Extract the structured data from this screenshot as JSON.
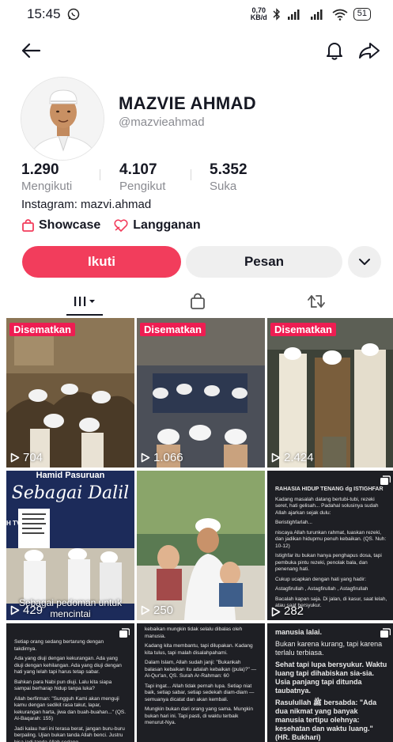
{
  "status_bar": {
    "time": "15:45",
    "speed_value": "0,70",
    "speed_unit": "KB/d",
    "battery": "51"
  },
  "profile": {
    "name": "MAZVIE AHMAD",
    "handle": "@mazvieahmad",
    "stats": [
      {
        "value": "1.290",
        "label": "Mengikuti"
      },
      {
        "value": "4.107",
        "label": "Pengikut"
      },
      {
        "value": "5.352",
        "label": "Suka"
      }
    ],
    "bio": "Instagram: mazvi.ahmad",
    "links": {
      "showcase": "Showcase",
      "subscription": "Langganan"
    }
  },
  "actions": {
    "follow": "Ikuti",
    "message": "Pesan"
  },
  "grid": {
    "pinned_label": "Disematkan",
    "items": [
      {
        "views": "704",
        "pinned": true
      },
      {
        "views": "1.066",
        "pinned": true
      },
      {
        "views": "2.424",
        "pinned": true
      },
      {
        "views": "429",
        "pinned": false,
        "overlay_top": "Hamid Pasuruan",
        "overlay_title": "Sebagai Dalil",
        "overlay_bottom": "Sebagai pedoman untuk mencintai",
        "overlay_left": "H TV"
      },
      {
        "views": "250",
        "pinned": false
      },
      {
        "views": "282",
        "pinned": false,
        "text_head": "RAHASIA HIDUP TENANG dg ISTIGHFAR",
        "text_lines": [
          "Kadang masalah datang bertubi-tubi, rezeki seret, hati gelisah... Padahal solusinya sudah Allah ajarkan sejak dulu:",
          "Beristighfarlah...",
          "niscaya Allah turunkan rahmat, luaskan rezeki, dan jadikan hidupmu penuh kebaikan. (QS. Nuh: 10-12)",
          "Istighfar itu bukan hanya penghapus dosa, tapi pembuka pintu rezeki, penolak bala, dan penenang hati.",
          "Cukup ucapkan dengan hati yang hadir:",
          "Astagfirullah , Astagfirullah , Astagfirullah",
          "Bacalah kapan saja. Di jalan, di kasur, saat lelah, atau saat bersyukur."
        ]
      },
      {
        "views": "",
        "pinned": false,
        "text_lines": [
          "Setiap orang sedang bertarung dengan takdirnya.",
          "Ada yang diuji dengan kekurangan. Ada yang diuji dengan kehilangan. Ada yang diuji dengan hati yang lelah tapi harus tetap sabar.",
          "Bahkan para Nabi pun diuji. Lalu kita siapa sampai berharap hidup tanpa luka?",
          "Allah berfirman: \"Sungguh Kami akan menguji kamu dengan sedikit rasa takut, lapar, kekurangan harta, jiwa dan buah-buahan...\" (QS. Al-Baqarah: 155)",
          "Jadi kalau hari ini terasa berat, jangan buru-buru berpaling. Ujian bukan tanda Allah benci. Justru bisa jadi tanda Allah sedang"
        ]
      },
      {
        "views": "",
        "pinned": false,
        "text_lines": [
          "kebaikan mungkin tidak selalu dibalas oleh manusia.",
          "Kadang kita membantu, tapi dilupakan. Kadang kita tulus, tapi malah disalahpahami.",
          "Dalam Islam, Allah sudah janji: \"Bukankah balasan kebaikan itu adalah kebaikan (pula)?\" — Al-Qur'an, QS. Surah Ar-Rahman: 60",
          "Tapi ingat... Allah tidak pernah lupa. Setiap niat baik, setiap sabar, setiap sedekah diam-diam — semuanya dicatat dan akan kembali.",
          "Mungkin bukan dari orang yang sama. Mungkin bukan hari ini. Tapi pasti, di waktu terbaik menurut-Nya."
        ]
      },
      {
        "views": "",
        "pinned": false,
        "text_lines": [
          "manusia lalai.",
          "Bukan karena kurang, tapi karena terlalu terbiasa.",
          "Sehat tapi lupa bersyukur. Waktu luang tapi dihabiskan sia-sia. Usia panjang tapi ditunda taubatnya.",
          "Rasulullah ﷺ bersabda: \"Ada dua nikmat yang banyak manusia tertipu olehnya: kesehatan dan waktu luang.\" (HR. Bukhari)"
        ]
      }
    ]
  }
}
